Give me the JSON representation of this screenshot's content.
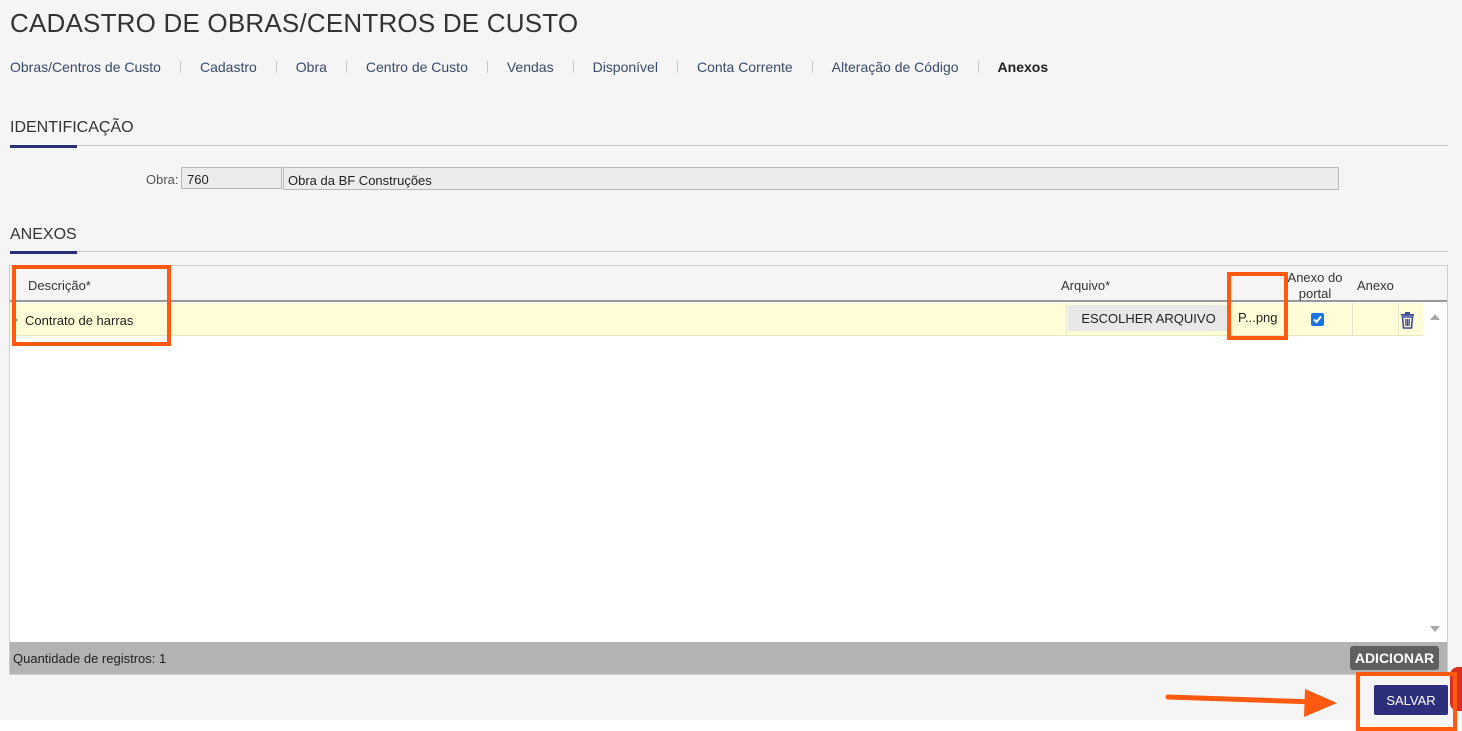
{
  "page": {
    "title": "CADASTRO DE OBRAS/CENTROS DE CUSTO"
  },
  "nav": [
    {
      "label": "Obras/Centros de Custo"
    },
    {
      "label": "Cadastro"
    },
    {
      "label": "Obra"
    },
    {
      "label": "Centro de Custo"
    },
    {
      "label": "Vendas"
    },
    {
      "label": "Disponível"
    },
    {
      "label": "Conta Corrente"
    },
    {
      "label": "Alteração de Código"
    },
    {
      "label": "Anexos"
    }
  ],
  "active_tab": "Anexos",
  "identificacao": {
    "title": "IDENTIFICAÇÃO",
    "obra_label": "Obra:",
    "obra_code": "760",
    "obra_name": "Obra da BF Construções"
  },
  "anexos": {
    "title": "ANEXOS",
    "columns": {
      "descricao": "Descrição*",
      "arquivo": "Arquivo*",
      "anexo_portal": "Anexo do portal",
      "anexo": "Anexo"
    },
    "rows": [
      {
        "descricao": "Contrato de harras",
        "file_button": "ESCOLHER ARQUIVO",
        "file_name": "P...png",
        "anexo_portal": true
      }
    ],
    "footer": {
      "count_label": "Quantidade de registros: 1",
      "add_button": "ADICIONAR"
    }
  },
  "actions": {
    "save_button": "SALVAR"
  },
  "colors": {
    "accent": "#2c2f7c",
    "highlight": "#ff5a0f",
    "row_selected": "#fefdd8",
    "checkbox": "#1a73e8"
  },
  "icons": [
    "trash-icon",
    "checkbox-checked-icon",
    "scroll-up-icon",
    "scroll-down-icon",
    "arrow-right-icon"
  ]
}
